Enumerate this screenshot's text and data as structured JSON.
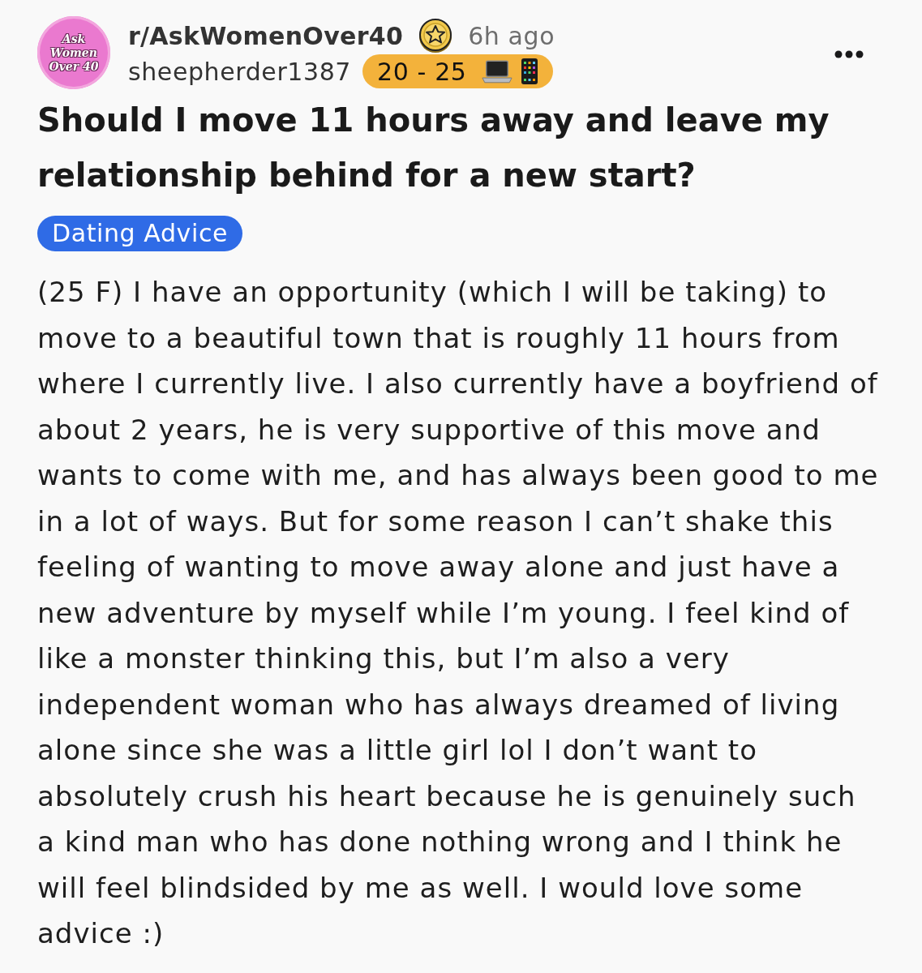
{
  "community": {
    "name": "r/AskWomenOver40",
    "logo_lines": [
      "Ask",
      "Women",
      "Over 40"
    ],
    "time": "6h ago"
  },
  "author": {
    "username": "sheepherder1387",
    "flair": "20 - 25"
  },
  "title": "Should I move 11 hours away and leave my relationship behind for a new start?",
  "post_flair": "Dating Advice",
  "body": "(25 F) I have an opportunity (which I will be taking) to move to a beautiful town that is roughly 11 hours from where I currently live. I also currently have a boyfriend of about 2 years, he is very supportive of this move and wants to come with me, and has always been good to me in a lot of ways. But for some reason I can’t shake this feeling of wanting to move away alone and just have a new adventure by myself while I’m young. I feel kind of like a monster thinking this, but I’m also a very independent woman who has always dreamed of living alone since she was a little girl lol I don’t want to absolutely crush his heart because he is genuinely such a kind man who has done nothing wrong and I think he will feel blindsided by me as well. I would love some advice :)"
}
